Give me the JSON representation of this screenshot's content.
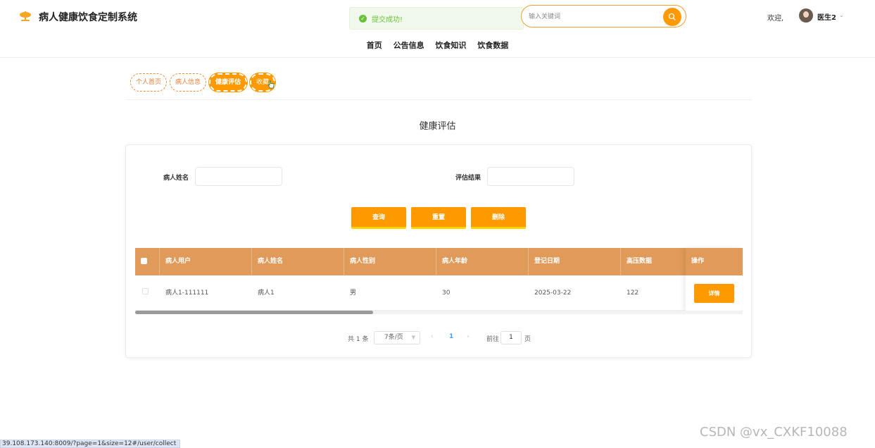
{
  "header": {
    "app_title": "病人健康饮食定制系统",
    "toast": "提交成功!",
    "search_placeholder": "输入关键词",
    "welcome": "欢迎,",
    "username": "医生2",
    "user_chevron": "⌄"
  },
  "nav": [
    "首页",
    "公告信息",
    "饮食知识",
    "饮食数据"
  ],
  "tabs": [
    "个人首页",
    "病人信息",
    "健康评估",
    "收藏"
  ],
  "page_title": "健康评估",
  "filters": {
    "patient_name_label": "病人姓名",
    "result_label": "评估结果"
  },
  "buttons": {
    "query": "查询",
    "reset": "重置",
    "delete": "删除"
  },
  "table": {
    "headers": [
      "病人用户",
      "病人姓名",
      "病人性别",
      "病人年龄",
      "登记日期",
      "高压数据",
      "操作"
    ],
    "rows": [
      [
        "病人1-111111",
        "病人1",
        "男",
        "30",
        "2025-03-22",
        "122"
      ]
    ],
    "detail_label": "详情"
  },
  "pagination": {
    "total": "共 1 条",
    "page_size": "7条/页",
    "current": "1",
    "goto": "前往",
    "goto_value": "1",
    "page_unit": "页"
  },
  "status_url": "39.108.173.140:8009/?page=1&size=12#/user/collect",
  "watermark": "CSDN @vx_CXKF10088",
  "colors": {
    "accent": "#ff9900",
    "table_header": "#e09a5a",
    "success": "#67c23a"
  }
}
